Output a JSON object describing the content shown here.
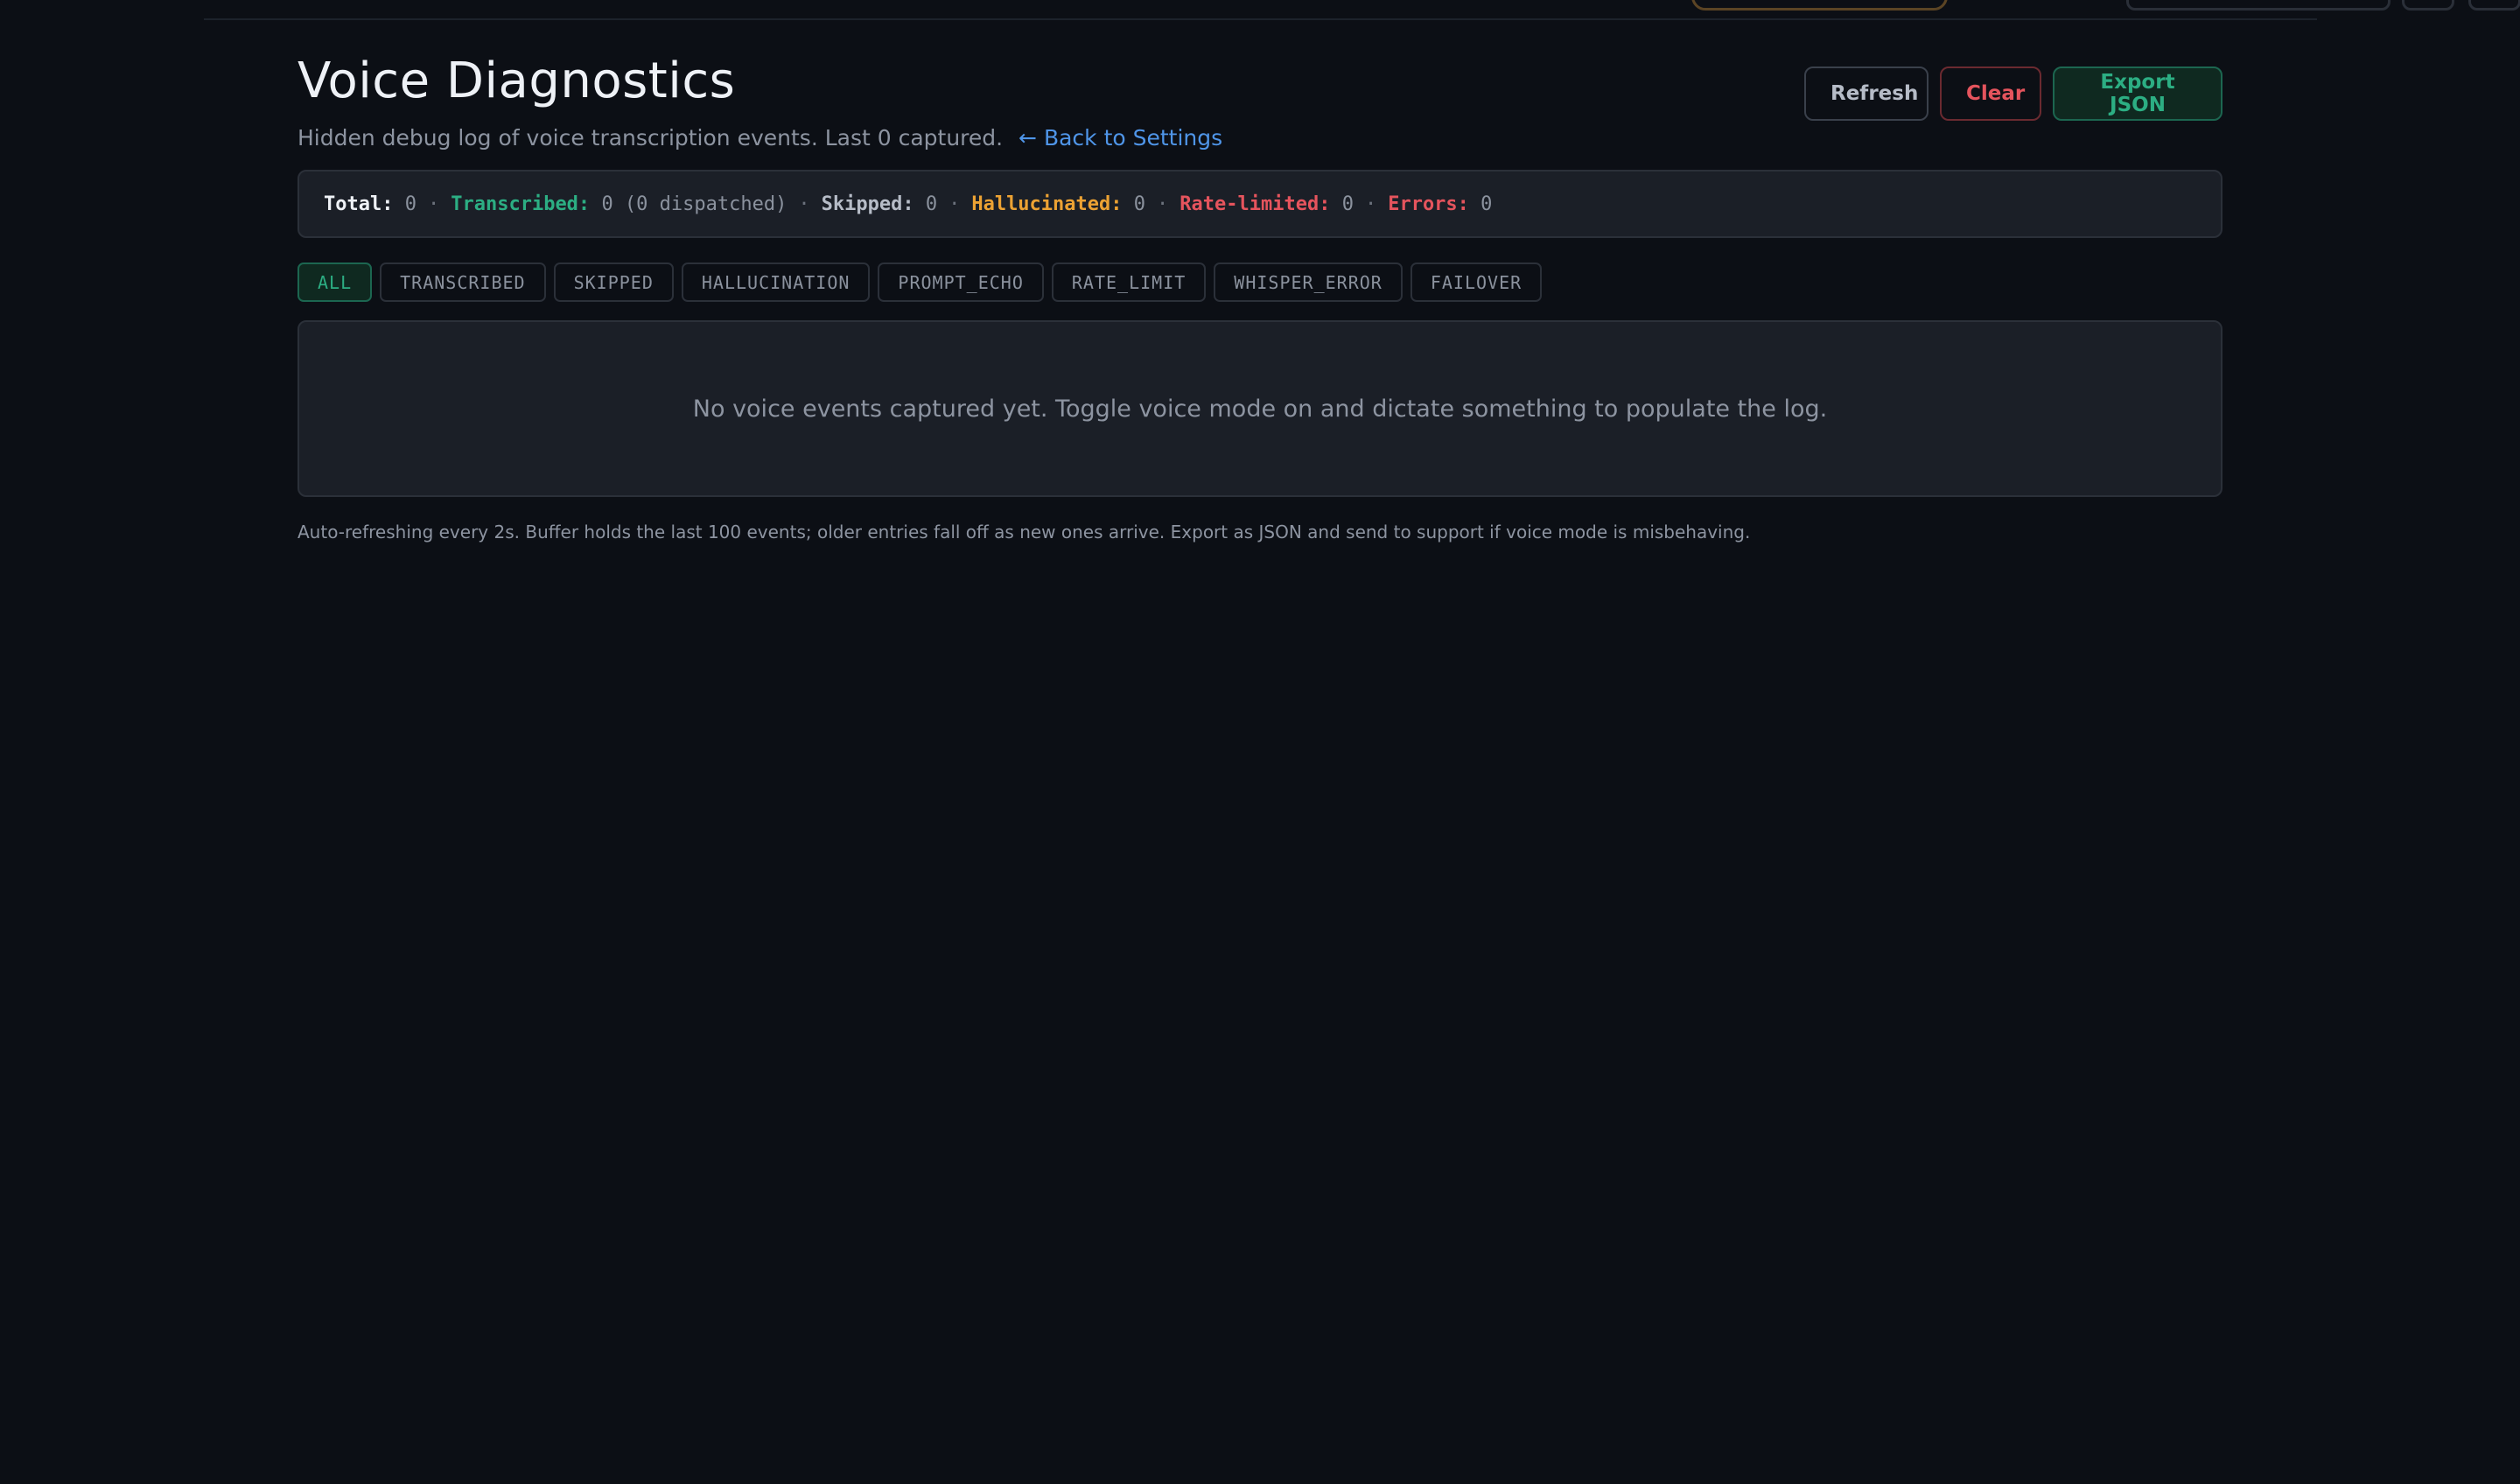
{
  "header": {
    "title": "Voice Diagnostics",
    "subtitle": "Hidden debug log of voice transcription events. Last 0 captured.",
    "back_link": "← Back to Settings"
  },
  "actions": {
    "refresh": "Refresh",
    "clear": "Clear",
    "export": "Export JSON"
  },
  "summary": {
    "total_label": "Total:",
    "total_value": "0",
    "transcribed_label": "Transcribed:",
    "transcribed_value": "0 (0 dispatched)",
    "skipped_label": "Skipped:",
    "skipped_value": "0",
    "hallucinated_label": "Hallucinated:",
    "hallucinated_value": "0",
    "rate_limited_label": "Rate-limited:",
    "rate_limited_value": "0",
    "errors_label": "Errors:",
    "errors_value": "0",
    "separator": "·"
  },
  "filters": [
    {
      "label": "ALL",
      "active": true
    },
    {
      "label": "TRANSCRIBED",
      "active": false
    },
    {
      "label": "SKIPPED",
      "active": false
    },
    {
      "label": "HALLUCINATION",
      "active": false
    },
    {
      "label": "PROMPT_ECHO",
      "active": false
    },
    {
      "label": "RATE_LIMIT",
      "active": false
    },
    {
      "label": "WHISPER_ERROR",
      "active": false
    },
    {
      "label": "FAILOVER",
      "active": false
    }
  ],
  "empty_state": "No voice events captured yet. Toggle voice mode on and dictate something to populate the log.",
  "footnote": "Auto-refreshing every 2s. Buffer holds the last 100 events; older entries fall off as new ones arrive. Export as JSON and send to support if voice mode is misbehaving.",
  "colors": {
    "background": "#0c0f15",
    "panel": "#1b1f27",
    "accent_green": "#2cae83",
    "accent_amber": "#eca233",
    "accent_red": "#e5545d",
    "link_blue": "#4f95e8"
  }
}
